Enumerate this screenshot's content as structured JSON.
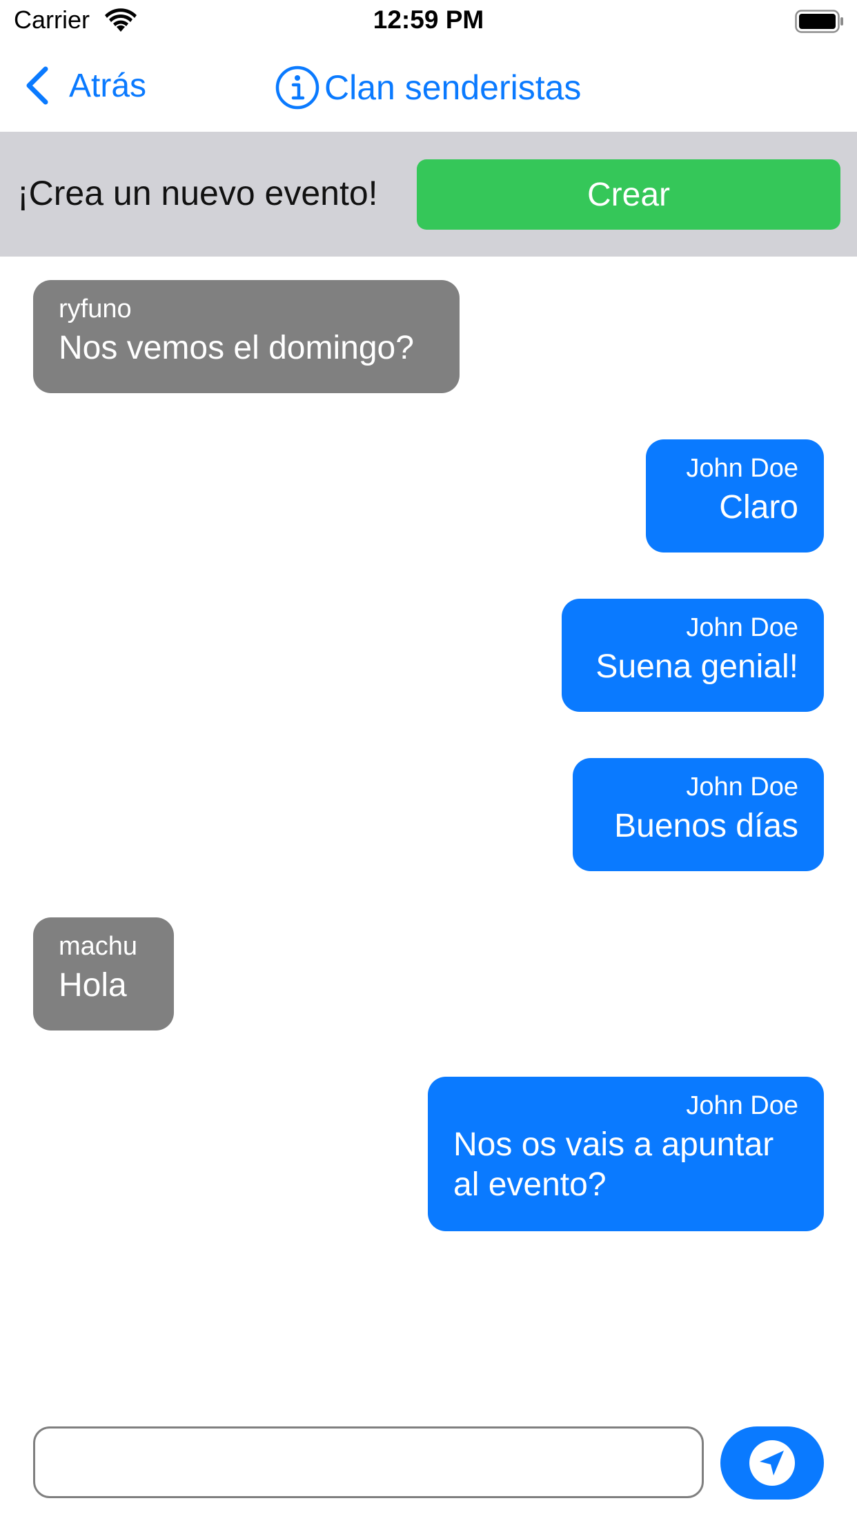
{
  "status_bar": {
    "carrier": "Carrier",
    "time": "12:59 PM",
    "wifi_icon": "wifi-icon",
    "battery_icon": "battery-icon"
  },
  "nav": {
    "back_label": "Atrás",
    "back_icon": "chevron-left-icon",
    "info_icon": "info-icon",
    "title": "Clan senderistas"
  },
  "event_bar": {
    "prompt": "¡Crea un nuevo evento!",
    "create_label": "Crear"
  },
  "messages": [
    {
      "sender": "ryfuno",
      "text": "Nos vemos el domingo?",
      "direction": "incoming"
    },
    {
      "sender": "John Doe",
      "text": "Claro",
      "direction": "outgoing"
    },
    {
      "sender": "John Doe",
      "text": "Suena genial!",
      "direction": "outgoing"
    },
    {
      "sender": "John Doe",
      "text": "Buenos días",
      "direction": "outgoing"
    },
    {
      "sender": "machu",
      "text": "Hola",
      "direction": "incoming"
    },
    {
      "sender": "John Doe",
      "text": "Nos os vais a apuntar al evento?",
      "direction": "outgoing"
    }
  ],
  "composer": {
    "placeholder": "",
    "value": "",
    "send_icon": "send-arrow-icon"
  },
  "colors": {
    "accent": "#0a7aff",
    "incoming_bubble": "#808080",
    "outgoing_bubble": "#0a7aff",
    "create_button": "#35c759",
    "event_bar": "#d2d2d7"
  }
}
